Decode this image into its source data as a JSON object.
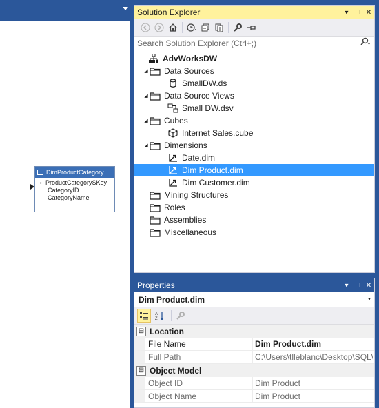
{
  "designer": {
    "table": {
      "name": "DimProductCategory",
      "columns": [
        {
          "name": "ProductCategorySKey",
          "is_key": true
        },
        {
          "name": "CategoryID",
          "is_key": false
        },
        {
          "name": "CategoryName",
          "is_key": false
        }
      ]
    }
  },
  "solution_explorer": {
    "title": "Solution Explorer",
    "title_buttons": [
      "▾",
      "⊣",
      "✕"
    ],
    "toolbar_icons": [
      "back-icon",
      "forward-icon",
      "home-icon",
      "history-icon",
      "collapse-all-icon",
      "show-all-files-icon",
      "properties-icon",
      "pin-icon"
    ],
    "search": {
      "placeholder": "Search Solution Explorer (Ctrl+;)"
    },
    "tree": [
      {
        "label": "AdvWorksDW",
        "level": 0,
        "icon": "solution-icon",
        "bold": true,
        "expander": ""
      },
      {
        "label": "Data Sources",
        "level": 1,
        "icon": "folder-icon",
        "expander": "◢"
      },
      {
        "label": "SmallDW.ds",
        "level": 2,
        "icon": "datasource-icon",
        "expander": ""
      },
      {
        "label": "Data Source Views",
        "level": 1,
        "icon": "folder-icon",
        "expander": "◢"
      },
      {
        "label": "Small DW.dsv",
        "level": 2,
        "icon": "dsv-icon",
        "expander": ""
      },
      {
        "label": "Cubes",
        "level": 1,
        "icon": "folder-icon",
        "expander": "◢"
      },
      {
        "label": "Internet Sales.cube",
        "level": 2,
        "icon": "cube-icon",
        "expander": ""
      },
      {
        "label": "Dimensions",
        "level": 1,
        "icon": "folder-icon",
        "expander": "◢"
      },
      {
        "label": "Date.dim",
        "level": 2,
        "icon": "dimension-icon",
        "expander": ""
      },
      {
        "label": "Dim Product.dim",
        "level": 2,
        "icon": "dimension-icon",
        "expander": "",
        "selected": true
      },
      {
        "label": "Dim Customer.dim",
        "level": 2,
        "icon": "dimension-icon",
        "expander": ""
      },
      {
        "label": "Mining Structures",
        "level": 1,
        "icon": "folder-icon",
        "expander": ""
      },
      {
        "label": "Roles",
        "level": 1,
        "icon": "folder-icon",
        "expander": ""
      },
      {
        "label": "Assemblies",
        "level": 1,
        "icon": "folder-icon",
        "expander": ""
      },
      {
        "label": "Miscellaneous",
        "level": 1,
        "icon": "folder-icon",
        "expander": ""
      }
    ]
  },
  "properties": {
    "title": "Properties",
    "title_buttons": [
      "▾",
      "⊣",
      "✕"
    ],
    "object": "Dim Product.dim",
    "categories": [
      {
        "name": "Location",
        "toggle": "⊟",
        "rows": [
          {
            "name": "File Name",
            "value": "Dim Product.dim",
            "readonly": false
          },
          {
            "name": "Full Path",
            "value": "C:\\Users\\tlleblanc\\Desktop\\SQL\\I",
            "readonly": true
          }
        ]
      },
      {
        "name": "Object Model",
        "toggle": "⊟",
        "rows": [
          {
            "name": "Object ID",
            "value": "Dim Product",
            "readonly": true
          },
          {
            "name": "Object Name",
            "value": "Dim Product",
            "readonly": true
          }
        ]
      }
    ]
  }
}
